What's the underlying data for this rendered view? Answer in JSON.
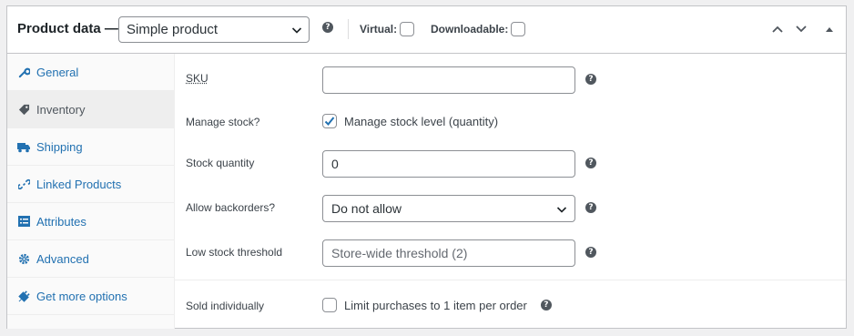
{
  "header": {
    "title": "Product data —",
    "product_type": "Simple product",
    "virtual_label": "Virtual:",
    "downloadable_label": "Downloadable:",
    "help_glyph": "?"
  },
  "sidebar": {
    "items": [
      {
        "label": "General",
        "icon": "wrench-icon"
      },
      {
        "label": "Inventory",
        "icon": "tag-icon"
      },
      {
        "label": "Shipping",
        "icon": "truck-icon"
      },
      {
        "label": "Linked Products",
        "icon": "link-icon"
      },
      {
        "label": "Attributes",
        "icon": "list-icon"
      },
      {
        "label": "Advanced",
        "icon": "gear-icon"
      },
      {
        "label": "Get more options",
        "icon": "plugin-icon"
      }
    ],
    "active": "Inventory"
  },
  "inventory": {
    "sku_label": "SKU",
    "sku_value": "",
    "manage_stock_label": "Manage stock?",
    "manage_stock_checkbox_label": "Manage stock level (quantity)",
    "manage_stock_checked": true,
    "stock_quantity_label": "Stock quantity",
    "stock_quantity_value": "0",
    "backorders_label": "Allow backorders?",
    "backorders_value": "Do not allow",
    "low_stock_label": "Low stock threshold",
    "low_stock_placeholder": "Store-wide threshold (2)",
    "sold_individually_label": "Sold individually",
    "sold_individually_checkbox_label": "Limit purchases to 1 item per order",
    "sold_individually_checked": false
  },
  "colors": {
    "accent": "#2271b1",
    "checkmark": "#2271b1",
    "border": "#c3c4c7"
  }
}
